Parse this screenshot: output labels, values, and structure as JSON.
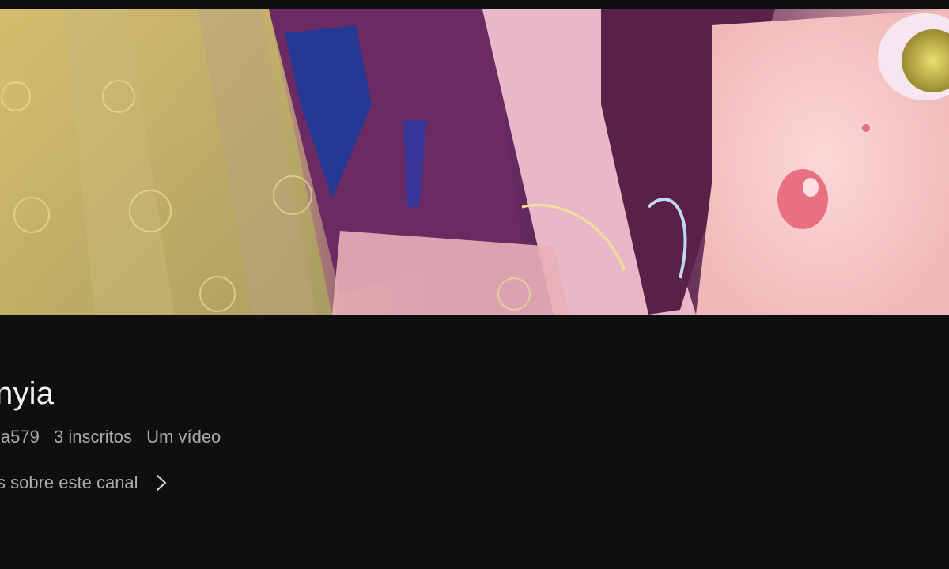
{
  "channel": {
    "name": "nyia",
    "handle": "ia579",
    "subscribers": "3 inscritos",
    "videos": "Um vídeo",
    "about_label": "s sobre este canal"
  },
  "colors": {
    "background": "#0f0f0f",
    "title": "#f1f1f1",
    "secondary_text": "#aaaaaa"
  },
  "icons": {
    "about_chevron": "chevron-right-icon"
  }
}
